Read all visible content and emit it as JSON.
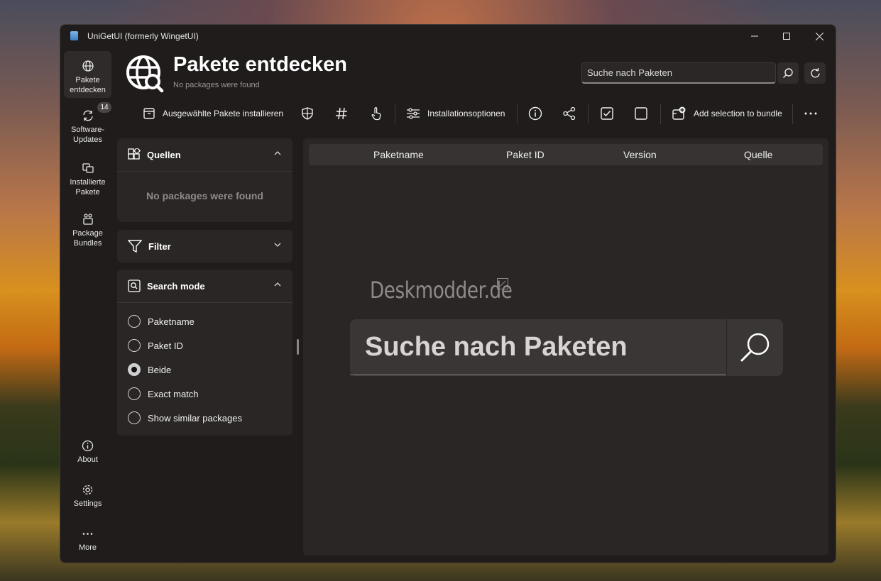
{
  "window": {
    "title": "UniGetUI (formerly WingetUI)"
  },
  "sidebar": {
    "items": [
      {
        "label": "Pakete\nentdecken",
        "icon": "globe-icon",
        "active": true
      },
      {
        "label": "Software-\nUpdates",
        "icon": "refresh-icon",
        "badge": "14"
      },
      {
        "label": "Installierte\nPakete",
        "icon": "installed-packages-icon"
      },
      {
        "label": "Package\nBundles",
        "icon": "bundle-icon"
      }
    ],
    "bottom": [
      {
        "label": "About",
        "icon": "info-icon"
      },
      {
        "label": "Settings",
        "icon": "gear-icon"
      },
      {
        "label": "More",
        "icon": "more-icon"
      }
    ]
  },
  "header": {
    "title": "Pakete entdecken",
    "subtitle": "No packages were found",
    "search_placeholder": "Suche nach Paketen"
  },
  "toolbar": {
    "install_label": "Ausgewählte Pakete installieren",
    "options_label": "Installationsoptionen",
    "bundle_label": "Add selection to bundle"
  },
  "sources_panel": {
    "title": "Quellen",
    "empty": "No packages were found"
  },
  "filter_panel": {
    "title": "Filter"
  },
  "search_mode_panel": {
    "title": "Search mode",
    "options": [
      "Paketname",
      "Paket ID",
      "Beide",
      "Exact match",
      "Show similar packages"
    ],
    "selected": "Beide"
  },
  "table": {
    "columns": [
      "Paketname",
      "Paket ID",
      "Version",
      "Quelle"
    ]
  },
  "center": {
    "watermark": "Deskmodder.de",
    "search_placeholder": "Suche nach Paketen"
  }
}
